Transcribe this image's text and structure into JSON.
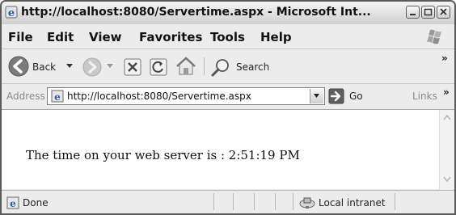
{
  "window": {
    "title": "http://localhost:8080/Servertime.aspx - Microsoft Int..."
  },
  "menu": {
    "items": [
      {
        "label": "File"
      },
      {
        "label": "Edit"
      },
      {
        "label": "View"
      },
      {
        "label": "Favorites"
      },
      {
        "label": "Tools"
      },
      {
        "label": "Help"
      }
    ]
  },
  "toolbar": {
    "back_label": "Back",
    "search_label": "Search",
    "overflow": "»"
  },
  "address": {
    "label": "Address",
    "url": "http://localhost:8080/Servertime.aspx",
    "go_label": "Go",
    "links_label": "Links",
    "overflow": "»"
  },
  "content": {
    "text": "The time on your web server is : 2:51:19 PM"
  },
  "status": {
    "left": "Done",
    "zone": "Local intranet"
  },
  "colors": {
    "back_button": "#3fa335",
    "go_button": "#4caf3a",
    "search_icon": "#3a6fc4"
  }
}
